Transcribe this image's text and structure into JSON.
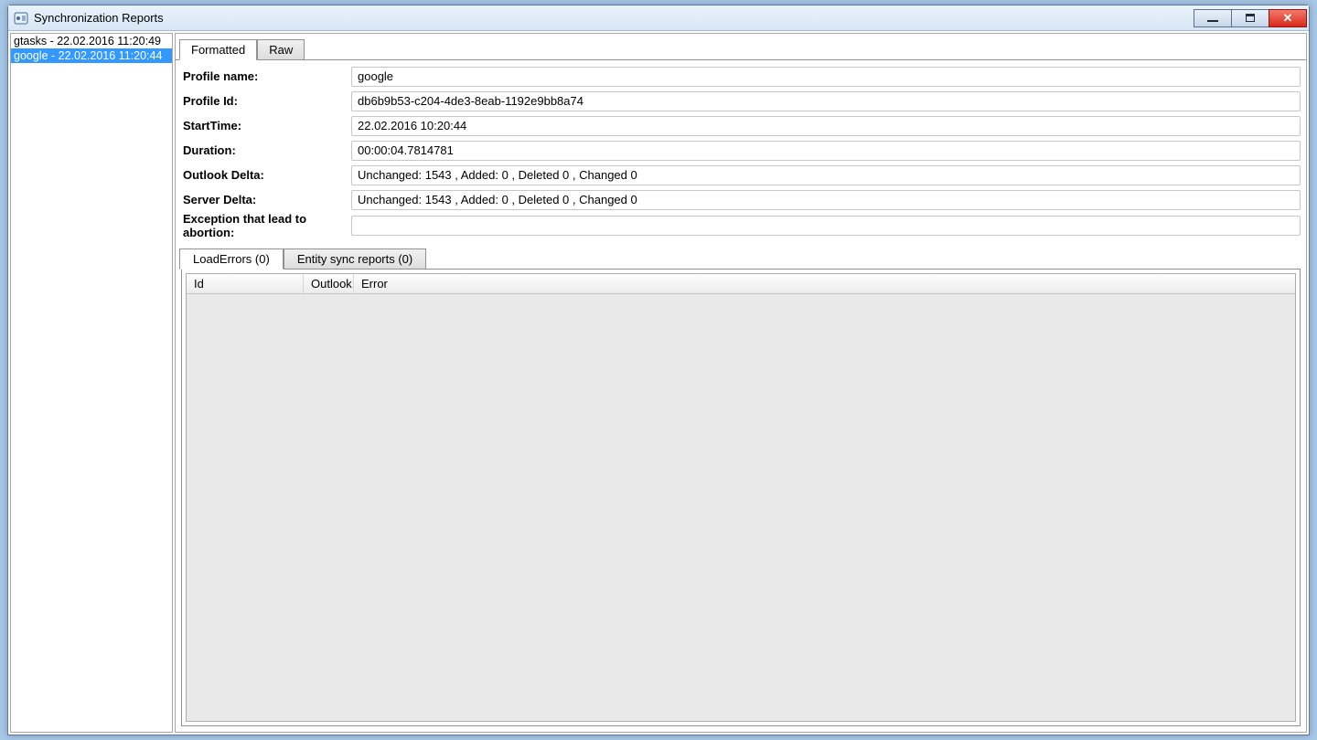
{
  "window": {
    "title": "Synchronization Reports"
  },
  "sidebar": {
    "items": [
      {
        "label": "gtasks - 22.02.2016 11:20:49",
        "selected": false
      },
      {
        "label": "google - 22.02.2016 11:20:44",
        "selected": true
      }
    ]
  },
  "top_tabs": {
    "formatted": "Formatted",
    "raw": "Raw",
    "active": "formatted"
  },
  "fields": {
    "profile_name": {
      "label": "Profile name:",
      "value": "google"
    },
    "profile_id": {
      "label": "Profile Id:",
      "value": "db6b9b53-c204-4de3-8eab-1192e9bb8a74"
    },
    "start_time": {
      "label": "StartTime:",
      "value": "22.02.2016 10:20:44"
    },
    "duration": {
      "label": "Duration:",
      "value": "00:00:04.7814781"
    },
    "outlook_delta": {
      "label": "Outlook Delta:",
      "value": "Unchanged: 1543 , Added: 0 , Deleted 0 ,  Changed 0"
    },
    "server_delta": {
      "label": "Server Delta:",
      "value": "Unchanged: 1543 , Added: 0 , Deleted 0 ,  Changed 0"
    },
    "exception": {
      "label": "Exception that lead to abortion:",
      "value": ""
    }
  },
  "sub_tabs": {
    "load_errors": "LoadErrors (0)",
    "entity_sync": "Entity sync reports (0)",
    "active": "load_errors"
  },
  "grid": {
    "columns": {
      "id": "Id",
      "outlook": "Outlook",
      "error": "Error"
    },
    "rows": []
  }
}
